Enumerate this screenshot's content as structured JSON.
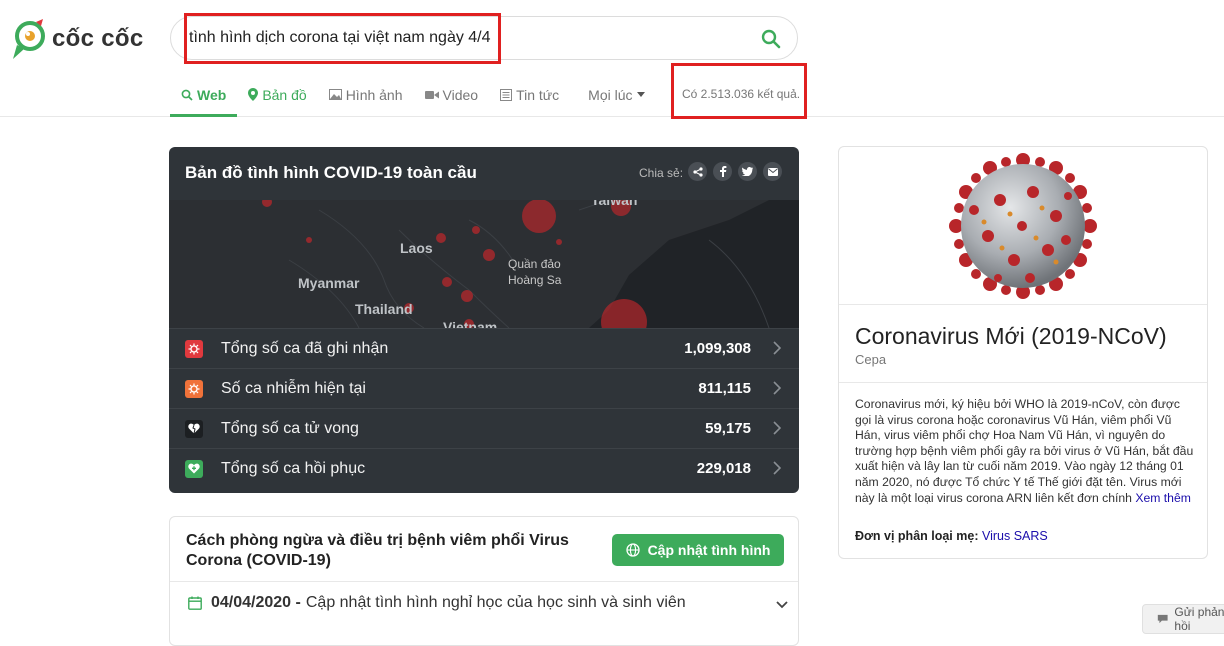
{
  "logo": {
    "text": "cốc cốc"
  },
  "search": {
    "value": "tình hình dịch corona tại việt nam ngày 4/4"
  },
  "tabs": [
    {
      "label": "Web",
      "icon": "search-icon"
    },
    {
      "label": "Bản đồ",
      "icon": "map-pin-icon"
    },
    {
      "label": "Hình ảnh",
      "icon": "image-icon"
    },
    {
      "label": "Video",
      "icon": "video-icon"
    },
    {
      "label": "Tin tức",
      "icon": "news-icon"
    },
    {
      "label": "Mọi lúc",
      "icon": "caret-down-icon"
    }
  ],
  "results_count": "Có 2.513.036 kết quả.",
  "covid": {
    "title": "Bản đồ tình hình COVID-19 toàn cầu",
    "share_label": "Chia sẻ:",
    "map_labels": {
      "taiwan": "Taiwan",
      "laos": "Laos",
      "myanmar": "Myanmar",
      "thailand": "Thailand",
      "vietnam": "Vietnam",
      "paracel_1": "Quần đảo",
      "paracel_2": "Hoàng Sa"
    },
    "stats": [
      {
        "label": "Tổng số ca đã ghi nhận",
        "value": "1,099,308",
        "color": "#e0393e"
      },
      {
        "label": "Số ca nhiễm hiện tại",
        "value": "811,115",
        "color": "#f0723a"
      },
      {
        "label": "Tổng số ca tử vong",
        "value": "59,175",
        "color": "#1c1f22"
      },
      {
        "label": "Tổng số ca hồi phục",
        "value": "229,018",
        "color": "#3dab5b"
      }
    ]
  },
  "prevention": {
    "title": "Cách phòng ngừa và điều trị bệnh viêm phổi Virus Corona (COVID-19)",
    "button": "Cập nhật tình hình",
    "update_date": "04/04/2020 -",
    "update_text": "Cập nhật tình hình nghỉ học của học sinh và sinh viên"
  },
  "knowledge_panel": {
    "title": "Coronavirus Mới (2019-NCoV)",
    "subtitle": "Cepa",
    "description": "Coronavirus mới, ký hiệu bởi WHO là 2019-nCoV, còn được gọi là virus corona hoặc coronavirus Vũ Hán, viêm phổi Vũ Hán, virus viêm phổi chợ Hoa Nam Vũ Hán, vì nguyên do trường hợp bệnh viêm phổi gây ra bởi virus ở Vũ Hán, bắt đầu xuất hiện và lây lan từ cuối năm 2019. Vào ngày 12 tháng 01 năm 2020, nó được Tổ chức Y tế Thế giới đặt tên. Virus mới này là một loại virus corona ARN liên kết đơn chính",
    "more_link": "Xem thêm",
    "class_label": "Đơn vị phân loại mẹ:",
    "class_value": "Virus SARS"
  },
  "feedback": {
    "label": "Gửi phản hồi"
  },
  "colors": {
    "accent": "#3dab5b",
    "highlight": "#e02020",
    "card_dark": "#2f3439"
  }
}
